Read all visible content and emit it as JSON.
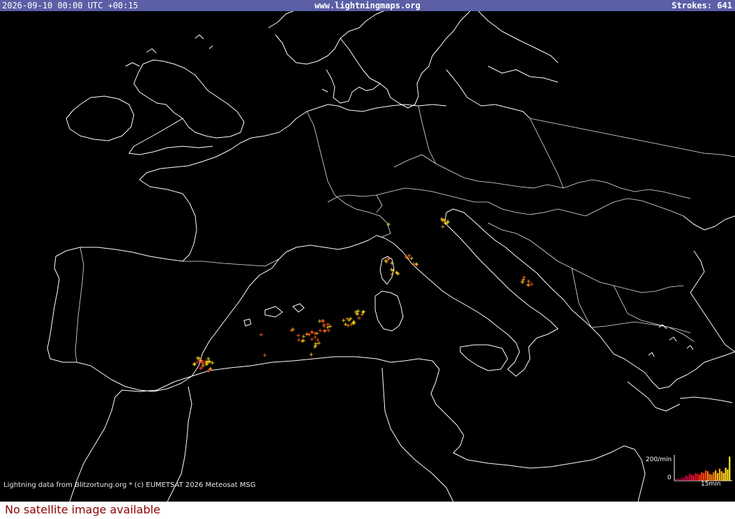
{
  "header": {
    "timestamp": "2026-09-10 00:00 UTC +00:15",
    "site": "www.lightningmaps.org",
    "strokes_label": "Strokes: 641"
  },
  "footer": {
    "credits": "Lightning data from Blitzortung.org  *  (c) EUMETSAT 2026 Meteosat MSG",
    "no_satellite": "No satellite image available"
  },
  "histogram": {
    "max_label": "200/min",
    "zero_label": "0",
    "window_label": "15min",
    "bars": [
      2,
      3,
      2,
      4,
      3,
      6,
      5,
      8,
      7,
      6,
      9,
      8,
      7,
      10,
      9,
      12,
      11,
      8,
      7,
      10,
      12,
      9,
      14,
      11,
      9,
      15,
      13,
      28
    ],
    "colors": [
      "#8a0030",
      "#c0003a",
      "#e4102a",
      "#ff4010",
      "#ff7a10",
      "#ffb010",
      "#ffe020"
    ]
  },
  "strokes": {
    "count": 641,
    "clusters": [
      {
        "name": "southern-spain",
        "color_old": "#ff3030",
        "color_new": "#ffe020"
      },
      {
        "name": "balearic-sea",
        "color_old": "#ff6020",
        "color_new": "#ffd020"
      },
      {
        "name": "ligurian-sea",
        "color_old": "#ff8020",
        "color_new": "#ffe020"
      },
      {
        "name": "northern-adriatic",
        "color_old": "#ff9020",
        "color_new": "#ffe020"
      },
      {
        "name": "southern-italy",
        "color_old": "#ff6020",
        "color_new": "#ffa020"
      }
    ]
  },
  "map": {
    "background": "#000000",
    "border_color": "#ffffff"
  }
}
